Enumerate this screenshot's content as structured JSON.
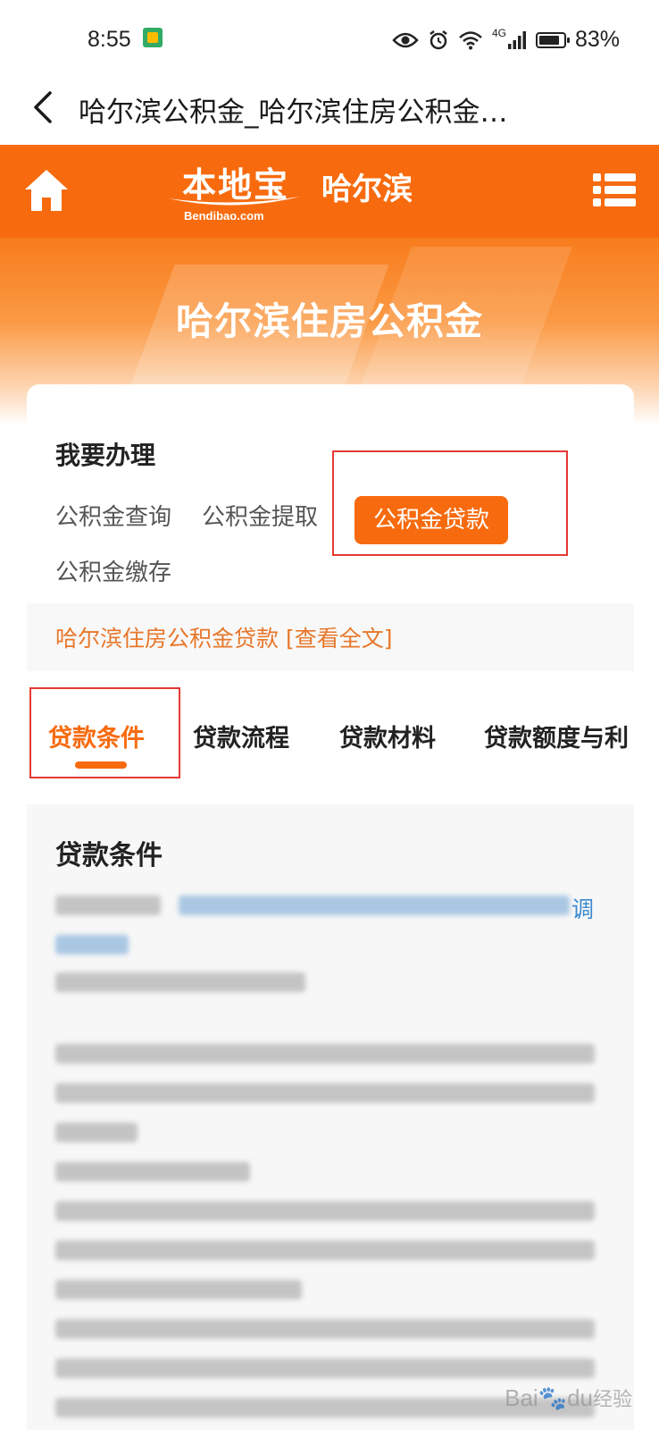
{
  "status_bar": {
    "time": "8:55",
    "network": "4G",
    "battery": "83%"
  },
  "nav": {
    "title": "哈尔滨公积金_哈尔滨住房公积金…"
  },
  "header": {
    "logo_main": "本地宝",
    "logo_sub": "Bendibao.com",
    "city": "哈尔滨"
  },
  "banner": {
    "title": "哈尔滨住房公积金"
  },
  "services": {
    "heading": "我要办理",
    "options": [
      "公积金查询",
      "公积金提取",
      "公积金贷款",
      "公积金缴存"
    ],
    "active": "公积金贷款"
  },
  "article_link": {
    "text": "哈尔滨住房公积金贷款 [查看全文]"
  },
  "tabs": {
    "items": [
      "贷款条件",
      "贷款流程",
      "贷款材料",
      "贷款额度与利"
    ],
    "active_index": 0
  },
  "content": {
    "title": "贷款条件",
    "link_tail_char": "调"
  },
  "watermark": {
    "brand": "Bai",
    "paw": "🐾",
    "brand_end": "du",
    "cn": "经验"
  },
  "colors": {
    "brand_orange": "#f76b0e",
    "highlight_red": "#e53935",
    "link_orange": "#e8772b"
  }
}
